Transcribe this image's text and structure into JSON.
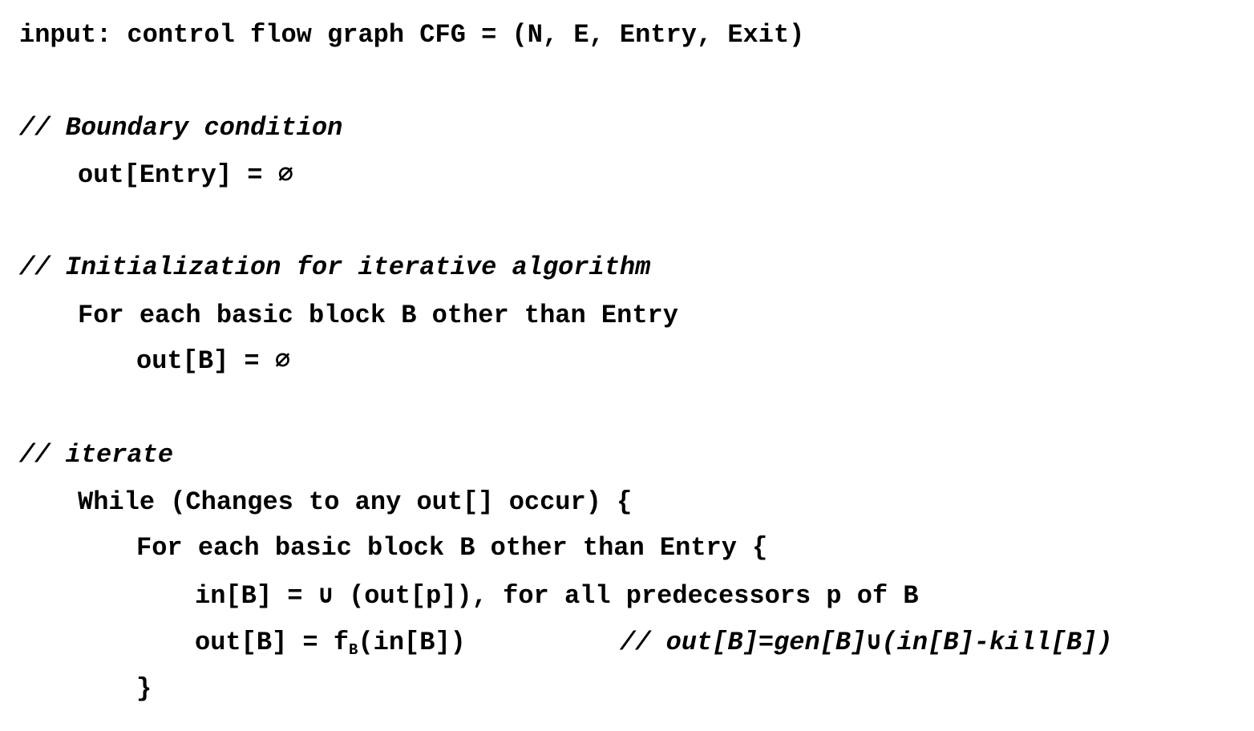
{
  "lines": {
    "input": "input: control flow graph CFG = (N, E, Entry, Exit)",
    "boundary_comment": "// Boundary condition",
    "out_entry": "out[Entry] = ∅",
    "init_comment": "// Initialization for iterative algorithm",
    "for_each_init": "For each basic block B other than Entry",
    "out_b_init": "out[B] = ∅",
    "iterate_comment": "// iterate",
    "while_line": "While (Changes to any out[] occur) {",
    "for_each_loop": "For each basic block B other than Entry {",
    "in_b": "in[B] = ∪ (out[p]), for all predecessors p of B",
    "out_b_prefix": "out[B] = f",
    "out_b_subscript": "B",
    "out_b_suffix": "(in[B])",
    "out_b_comment": "// out[B]=gen[B]∪(in[B]-kill[B])",
    "close_brace": "}"
  }
}
